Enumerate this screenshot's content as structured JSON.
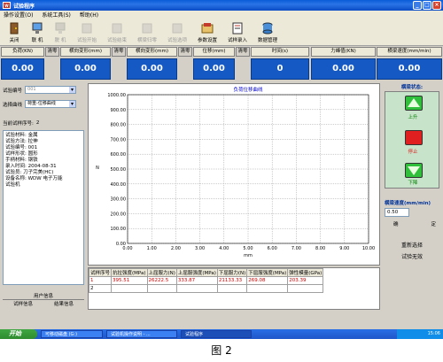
{
  "window": {
    "title": "试验程序"
  },
  "menu": [
    "操作设置(O)",
    "系统工具(S)",
    "帮助(H)"
  ],
  "toolbar": {
    "buttons": [
      {
        "label": "关闭",
        "enabled": true
      },
      {
        "label": "联  机",
        "enabled": true
      },
      {
        "label": "脱  机",
        "enabled": false
      },
      {
        "label": "试验开始",
        "enabled": false
      },
      {
        "label": "试验结束",
        "enabled": false
      },
      {
        "label": "横梁归零",
        "enabled": false
      },
      {
        "label": "试验选项",
        "enabled": false
      },
      {
        "label": "参数设置",
        "enabled": true
      },
      {
        "label": "试样录入",
        "enabled": true
      },
      {
        "label": "数据管理",
        "enabled": true
      }
    ]
  },
  "readouts": {
    "zero_label": "清零",
    "items": [
      {
        "label": "负荷(KN)",
        "value": "0.00"
      },
      {
        "label": "横向变形(mm)",
        "value": "0.00"
      },
      {
        "label": "横向变形(mm)",
        "value": "0.00"
      },
      {
        "label": "位移(mm)",
        "value": "0.00"
      },
      {
        "label": "时间(s)",
        "value": "0"
      },
      {
        "label": "力峰值(KN)",
        "value": "0.00"
      },
      {
        "label": "横梁速度(mm/min)",
        "value": "0.00"
      }
    ]
  },
  "left_panel": {
    "test_no_label": "试验编号",
    "test_no_value": "001",
    "curve_label": "选择曲线",
    "curve_value": "荷重-位移曲线",
    "current_sample_label": "当前试样序号:",
    "current_sample_value": "2",
    "info_text": "试验材料: 金属\n试验方法: 拉伸\n试验编号: 001\n试样形状: 圆形\n手柄材料: 钢铁\n录入时间: 2004-08-31\n试验员: 刀子完美(HC)\n设备名称: WDW 电子万能\n试验机",
    "tab_user": "用户信息",
    "tab_sample": "试样信息",
    "tab_result": "结果信息"
  },
  "chart_data": {
    "type": "line",
    "title": "负荷位移曲线",
    "xlabel": "mm",
    "ylabel": "N",
    "xlim": [
      0,
      10
    ],
    "ylim": [
      0,
      1000
    ],
    "x_ticks": [
      "0.00",
      "1.00",
      "2.00",
      "3.00",
      "4.00",
      "5.00",
      "6.00",
      "7.00",
      "8.00",
      "9.00",
      "10.00"
    ],
    "y_ticks": [
      "0.00",
      "100.00",
      "200.00",
      "300.00",
      "400.00",
      "500.00",
      "600.00",
      "700.00",
      "800.00",
      "900.00",
      "1000.00"
    ],
    "grid": true,
    "series": []
  },
  "right_panel": {
    "status_title": "横梁状态:",
    "up_label": "上升",
    "stop_label": "停止",
    "down_label": "下降",
    "speed_label": "横梁速度(mm/min)",
    "speed_value": "0.50",
    "confirm_label": "确",
    "cancel_label": "定",
    "reselect_label": "重新选择",
    "invalid_label": "试验无效"
  },
  "results_table": {
    "headers": [
      "试样序号",
      "抗拉强度(MPa)",
      "上屈服力(N)",
      "上屈服强度(MPa)",
      "下屈服力(N)",
      "下屈服强度(MPa)",
      "弹性模量(GPa)"
    ],
    "rows": [
      [
        "1",
        "395.51",
        "26222.5",
        "333.87",
        "21133.33",
        "269.08",
        "203.39"
      ],
      [
        "2",
        "",
        "",
        "",
        "",
        "",
        ""
      ]
    ]
  },
  "taskbar": {
    "start": "开始",
    "tasks": [
      "可移动磁盘 (G:)",
      "试验机操作说明 - ...",
      "试验程序"
    ],
    "clock": "15:06"
  },
  "caption": "图 2"
}
